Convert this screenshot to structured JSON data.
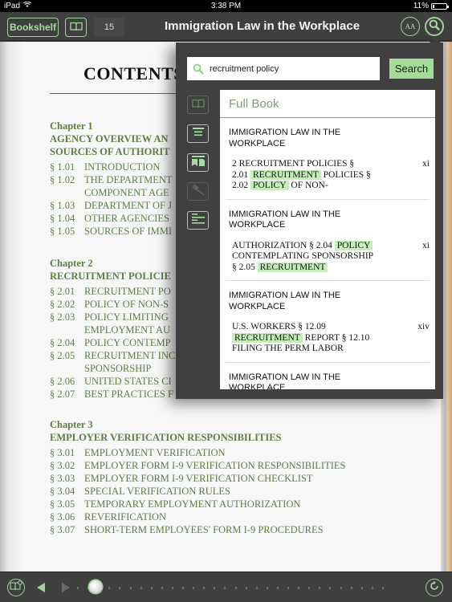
{
  "status_bar": {
    "device": "iPad",
    "time": "3:38 PM",
    "battery": "11%",
    "battery_level": 0.11
  },
  "toolbar": {
    "bookshelf_label": "Bookshelf",
    "page_number": "15",
    "title": "Immigration Law in the Workplace",
    "font_size_label": "AA"
  },
  "page": {
    "heading": "CONTENTS",
    "chapters": [
      {
        "label": "Chapter 1",
        "title_lines": [
          "AGENCY OVERVIEW AN",
          "SOURCES OF AUTHORIT"
        ],
        "sections": [
          {
            "num": "§ 1.01",
            "lines": [
              "INTRODUCTION"
            ]
          },
          {
            "num": "§ 1.02",
            "lines": [
              "THE DEPARTMENT",
              "COMPONENT AGE"
            ]
          },
          {
            "num": "§ 1.03",
            "lines": [
              "DEPARTMENT OF J"
            ]
          },
          {
            "num": "§ 1.04",
            "lines": [
              "OTHER AGENCIES"
            ]
          },
          {
            "num": "§ 1.05",
            "lines": [
              "SOURCES OF IMMI"
            ]
          }
        ]
      },
      {
        "label": "Chapter 2",
        "title_lines": [
          "RECRUITMENT POLICIE"
        ],
        "sections": [
          {
            "num": "§ 2.01",
            "lines": [
              "RECRUITMENT PO"
            ]
          },
          {
            "num": "§ 2.02",
            "lines": [
              "POLICY OF NON-S"
            ]
          },
          {
            "num": "§ 2.03",
            "lines": [
              "POLICY LIMITING",
              "EMPLOYMENT AU"
            ]
          },
          {
            "num": "§ 2.04",
            "lines": [
              "POLICY CONTEMP"
            ]
          },
          {
            "num": "§ 2.05",
            "lines": [
              "RECRUITMENT INC",
              "SPONSORSHIP"
            ]
          },
          {
            "num": "§ 2.06",
            "lines": [
              "UNITED STATES CI"
            ]
          },
          {
            "num": "§ 2.07",
            "lines": [
              "BEST PRACTICES F"
            ]
          }
        ]
      },
      {
        "label": "Chapter 3",
        "title_lines": [
          "EMPLOYER VERIFICATION RESPONSIBILITIES"
        ],
        "sections": [
          {
            "num": "§ 3.01",
            "lines": [
              "EMPLOYMENT VERIFICATION"
            ]
          },
          {
            "num": "§ 3.02",
            "lines": [
              "EMPLOYER FORM I-9 VERIFICATION RESPONSIBILITIES"
            ]
          },
          {
            "num": "§ 3.03",
            "lines": [
              "EMPLOYER FORM I-9 VERIFICATION CHECKLIST"
            ]
          },
          {
            "num": "§ 3.04",
            "lines": [
              "SPECIAL VERIFICATION RULES"
            ]
          },
          {
            "num": "§ 3.05",
            "lines": [
              "TEMPORARY EMPLOYMENT AUTHORIZATION"
            ]
          },
          {
            "num": "§ 3.06",
            "lines": [
              "REVERIFICATION"
            ]
          },
          {
            "num": "§ 3.07",
            "lines": [
              "SHORT-TERM EMPLOYEES' FORM I-9 PROCEDURES"
            ]
          }
        ]
      }
    ]
  },
  "search": {
    "query": "recruitment policy",
    "button_label": "Search",
    "scope_header": "Full Book",
    "results": [
      {
        "title": "IMMIGRATION LAW IN THE WORKPLACE",
        "page": "xi",
        "snippet": [
          {
            "t": "2 RECRUITMENT POLICIES §"
          },
          {
            "br": true
          },
          {
            "t": "2.01 "
          },
          {
            "h": "RECRUITMENT"
          },
          {
            "t": " POLICIES §"
          },
          {
            "br": true
          },
          {
            "t": "2.02 "
          },
          {
            "h": "POLICY"
          },
          {
            "t": " OF NON-"
          }
        ]
      },
      {
        "title": "IMMIGRATION LAW IN THE WORKPLACE",
        "page": "xi",
        "snippet": [
          {
            "t": "AUTHORIZATION § 2.04 "
          },
          {
            "h": "POLICY"
          },
          {
            "br": true
          },
          {
            "t": "CONTEMPLATING SPONSORSHIP"
          },
          {
            "br": true
          },
          {
            "t": "§ 2.05 "
          },
          {
            "h": "RECRUITMENT"
          }
        ]
      },
      {
        "title": "IMMIGRATION LAW IN THE WORKPLACE",
        "page": "xiv",
        "snippet": [
          {
            "t": "U.S. WORKERS § 12.09"
          },
          {
            "br": true
          },
          {
            "h": "RECRUITMENT"
          },
          {
            "t": " REPORT § 12.10"
          },
          {
            "br": true
          },
          {
            "t": "FILING THE PERM LABOR"
          }
        ]
      },
      {
        "title": "IMMIGRATION LAW IN THE WORKPLACE",
        "page": "",
        "snippet": []
      }
    ],
    "side_icons": [
      "full-book-icon",
      "chapter-icon",
      "bookmarks-icon",
      "gavel-icon",
      "notes-icon"
    ]
  },
  "bottom_bar": {
    "page_progress": 0.06,
    "slider_dot_count": 30
  },
  "colors": {
    "accent": "#9fd49a",
    "highlight": "#c5efb8",
    "toc_text": "#5e7d45",
    "toolbar_bg": "#3f3f3f"
  }
}
